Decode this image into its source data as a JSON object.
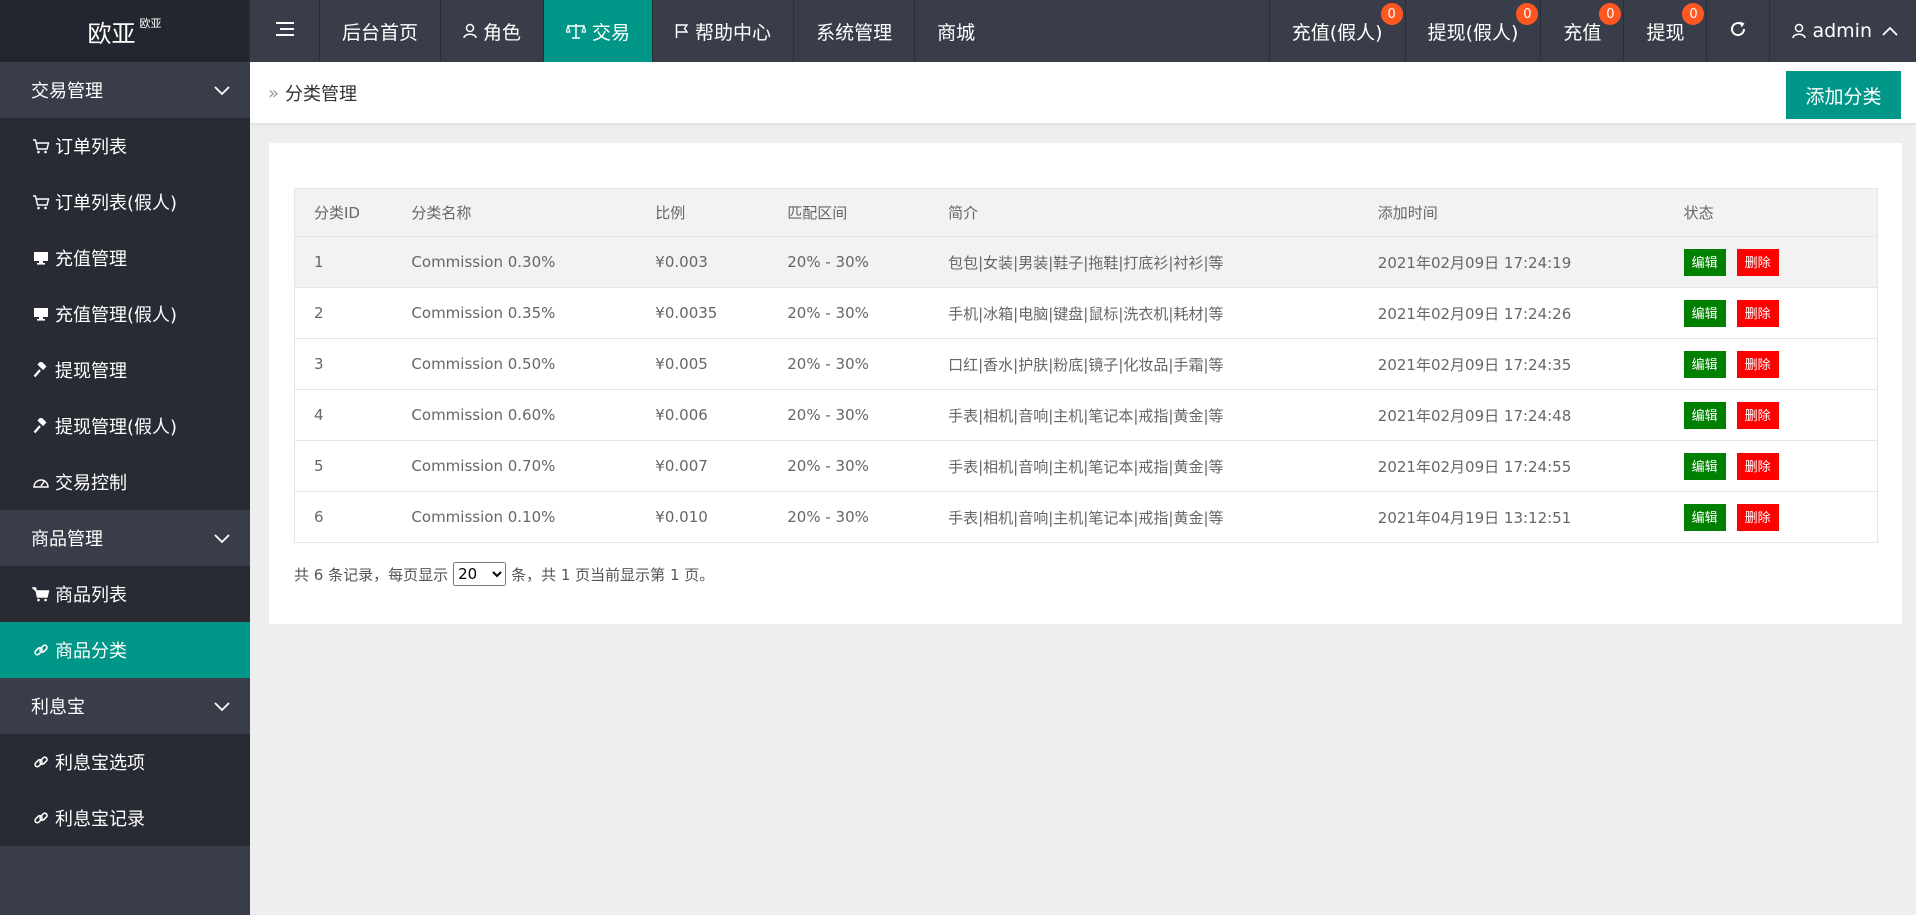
{
  "app": {
    "logo": "欧亚",
    "logo_sup": "欧亚"
  },
  "topnav": {
    "left": [
      {
        "label": "后台首页",
        "icon": ""
      },
      {
        "label": "角色",
        "icon": "user-icon"
      },
      {
        "label": "交易",
        "icon": "scale-icon",
        "active": true
      },
      {
        "label": "帮助中心",
        "icon": "flag-icon"
      },
      {
        "label": "系统管理",
        "icon": ""
      },
      {
        "label": "商城",
        "icon": ""
      }
    ],
    "right": [
      {
        "label": "充值(假人)",
        "badge": "0"
      },
      {
        "label": "提现(假人)",
        "badge": "0"
      },
      {
        "label": "充值",
        "badge": "0"
      },
      {
        "label": "提现",
        "badge": "0"
      }
    ],
    "user": "admin"
  },
  "sidebar": {
    "groups": [
      {
        "label": "交易管理",
        "items": [
          {
            "label": "订单列表",
            "icon": "cart-icon"
          },
          {
            "label": "订单列表(假人)",
            "icon": "cart-icon"
          },
          {
            "label": "充值管理",
            "icon": "monitor-icon"
          },
          {
            "label": "充值管理(假人)",
            "icon": "monitor-icon"
          },
          {
            "label": "提现管理",
            "icon": "hammer-icon"
          },
          {
            "label": "提现管理(假人)",
            "icon": "hammer-icon"
          },
          {
            "label": "交易控制",
            "icon": "gauge-icon"
          }
        ]
      },
      {
        "label": "商品管理",
        "items": [
          {
            "label": "商品列表",
            "icon": "cart-icon"
          },
          {
            "label": "商品分类",
            "icon": "link-icon",
            "active": true
          }
        ]
      },
      {
        "label": "利息宝",
        "items": [
          {
            "label": "利息宝选项",
            "icon": "link-icon"
          },
          {
            "label": "利息宝记录",
            "icon": "link-icon"
          }
        ]
      }
    ]
  },
  "header": {
    "breadcrumb": "分类管理",
    "add_button": "添加分类"
  },
  "table": {
    "columns": [
      "分类ID",
      "分类名称",
      "比例",
      "匹配区间",
      "简介",
      "添加时间",
      "状态"
    ],
    "rows": [
      [
        "1",
        "Commission 0.30%",
        "¥0.003",
        "20% - 30%",
        "包包|女装|男装|鞋子|拖鞋|打底衫|衬衫|等",
        "2021年02月09日 17:24:19"
      ],
      [
        "2",
        "Commission 0.35%",
        "¥0.0035",
        "20% - 30%",
        "手机|冰箱|电脑|键盘|鼠标|洗衣机|耗材|等",
        "2021年02月09日 17:24:26"
      ],
      [
        "3",
        "Commission 0.50%",
        "¥0.005",
        "20% - 30%",
        "口红|香水|护肤|粉底|镜子|化妆品|手霜|等",
        "2021年02月09日 17:24:35"
      ],
      [
        "4",
        "Commission 0.60%",
        "¥0.006",
        "20% - 30%",
        "手表|相机|音响|主机|笔记本|戒指|黄金|等",
        "2021年02月09日 17:24:48"
      ],
      [
        "5",
        "Commission 0.70%",
        "¥0.007",
        "20% - 30%",
        "手表|相机|音响|主机|笔记本|戒指|黄金|等",
        "2021年02月09日 17:24:55"
      ],
      [
        "6",
        "Commission 0.10%",
        "¥0.010",
        "20% - 30%",
        "手表|相机|音响|主机|笔记本|戒指|黄金|等",
        "2021年04月19日 13:12:51"
      ]
    ],
    "edit_label": "编辑",
    "delete_label": "删除"
  },
  "pagination": {
    "prefix": "共 6 条记录，每页显示",
    "page_size": "20",
    "suffix": "条，共 1 页当前显示第 1 页。"
  },
  "colors": {
    "accent": "#009688",
    "topbar": "#393d49",
    "badge": "#ff5722",
    "edit": "#008000",
    "delete": "#ff0000"
  }
}
